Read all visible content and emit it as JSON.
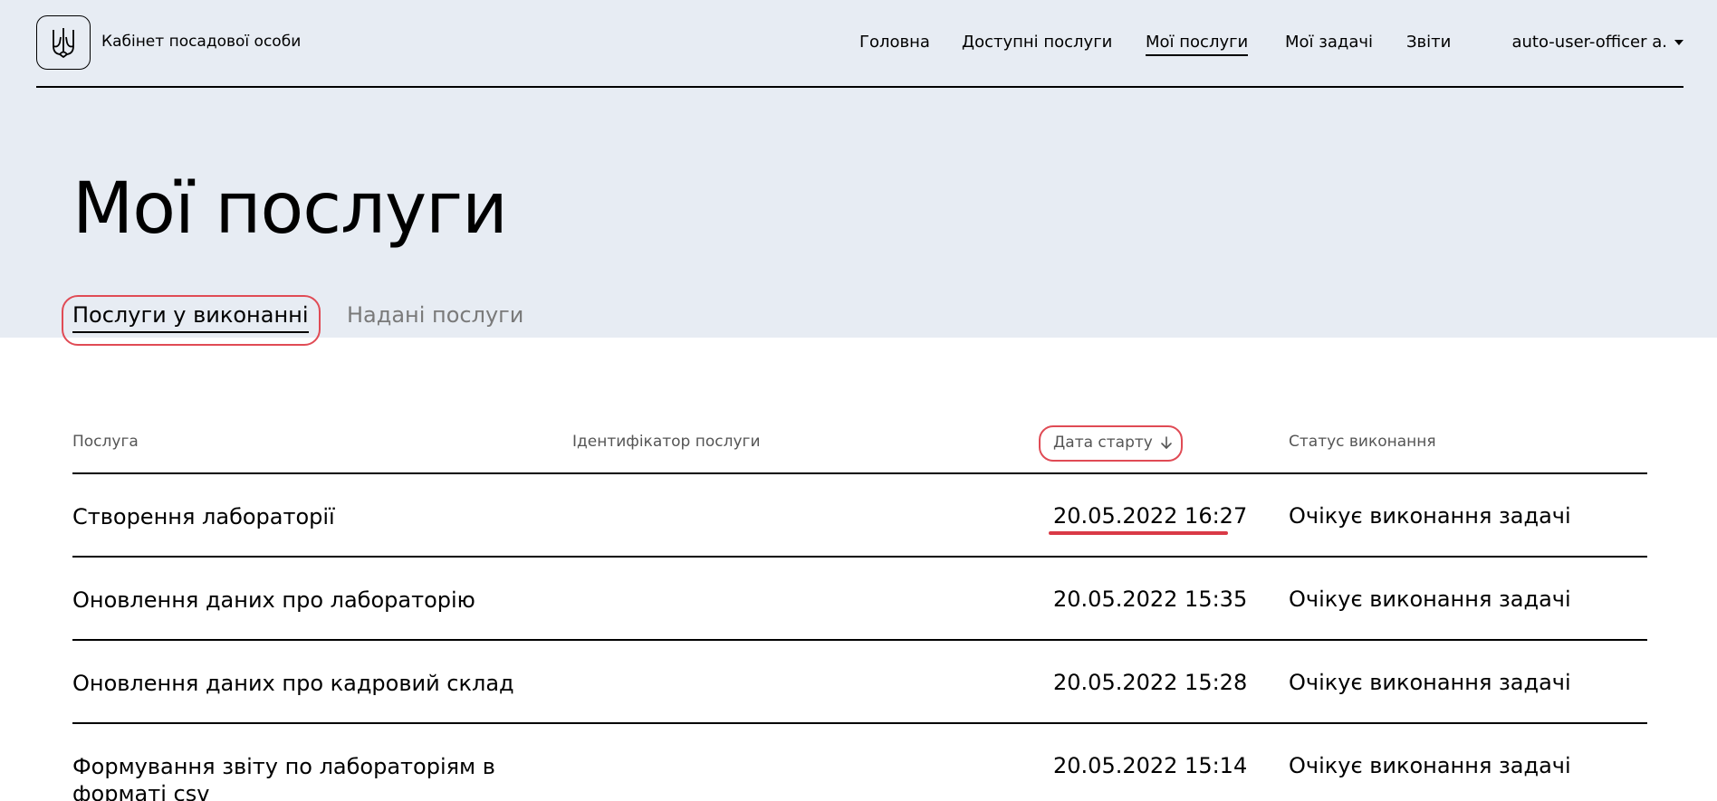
{
  "header": {
    "brand": "Кабінет посадової особи",
    "nav": [
      {
        "label": "Головна"
      },
      {
        "label": "Доступні послуги"
      },
      {
        "label": "Мої послуги"
      },
      {
        "label": "Мої задачі"
      },
      {
        "label": "Звіти"
      }
    ],
    "active_nav": "Мої послуги",
    "user": "auto-user-officer a."
  },
  "page": {
    "title": "Мої послуги"
  },
  "tabs": [
    {
      "label": "Послуги у виконанні"
    },
    {
      "label": "Надані послуги"
    }
  ],
  "table": {
    "columns": [
      "Послуга",
      "Ідентифікатор послуги",
      "Дата старту",
      "Статус виконання"
    ],
    "sort_icon": "arrow-down-icon",
    "rows": [
      {
        "service": "Створення лабораторії",
        "id": "",
        "date": "20.05.2022 16:27",
        "status": "Очікує виконання задачі"
      },
      {
        "service": "Оновлення даних про лабораторію",
        "id": "",
        "date": "20.05.2022 15:35",
        "status": "Очікує виконання задачі"
      },
      {
        "service": "Оновлення даних про кадровий склад",
        "id": "",
        "date": "20.05.2022 15:28",
        "status": "Очікує виконання задачі"
      },
      {
        "service": "Формування звіту по лабораторіям в форматі csv",
        "id": "",
        "date": "20.05.2022 15:14",
        "status": "Очікує виконання задачі"
      }
    ]
  },
  "colors": {
    "hero_bg": "#e7ecf3",
    "annotation": "#e04b55"
  }
}
